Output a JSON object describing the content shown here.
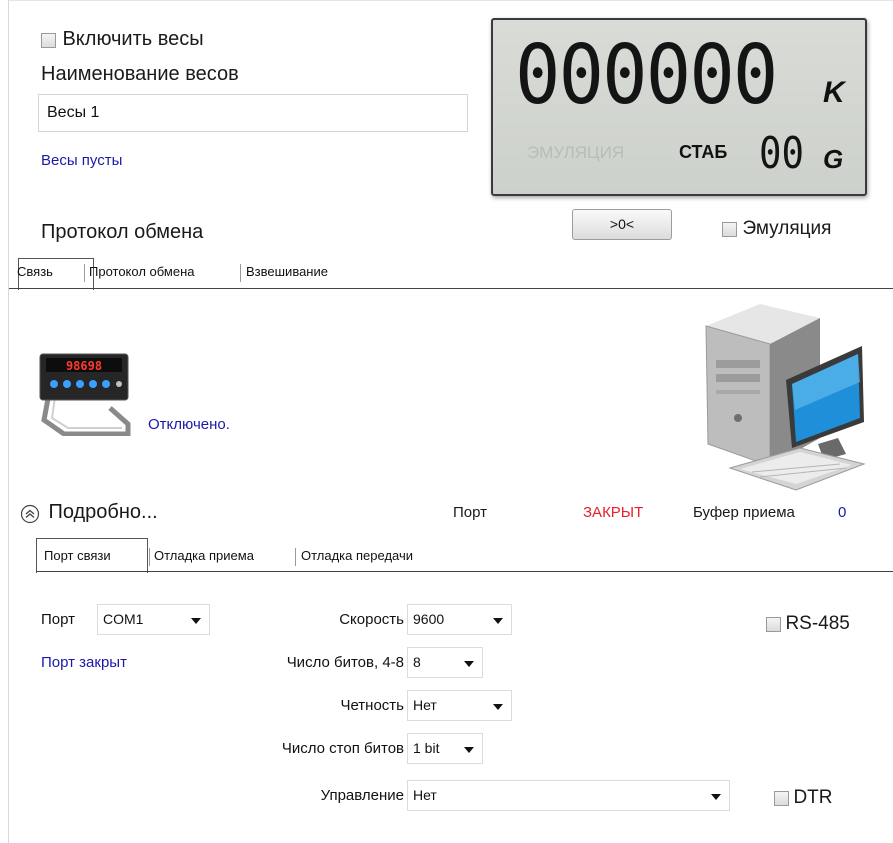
{
  "top": {
    "enable_scales_label": "Включить весы",
    "scales_name_label": "Наименование весов",
    "scales_name_value": "Весы 1",
    "status_text": "Весы пусты",
    "protocol_label": "Протокол обмена"
  },
  "display": {
    "digits": "000000",
    "unit_k": "K",
    "emulation_indicator": "ЭМУЛЯЦИЯ",
    "stab_label": "СТАБ",
    "small_digits": "00",
    "unit_g": "G"
  },
  "controls": {
    "zero_button": ">0<",
    "emulation_label": "Эмуляция"
  },
  "tabs": [
    {
      "label": "Связь"
    },
    {
      "label": "Протокол обмена"
    },
    {
      "label": "Взвешивание"
    }
  ],
  "connection": {
    "state_text": "Отключено.",
    "details_label": "Подробно...",
    "port_label": "Порт",
    "port_state": "ЗАКРЫТ",
    "rx_buffer_label": "Буфер приема",
    "rx_buffer_value": "0"
  },
  "subtabs": [
    {
      "label": "Порт связи"
    },
    {
      "label": "Отладка приема"
    },
    {
      "label": "Отладка передачи"
    }
  ],
  "port_settings": {
    "port_label": "Порт",
    "port_value": "COM1",
    "port_status": "Порт закрыт",
    "speed_label": "Скорость",
    "speed_value": "9600",
    "bits_label": "Число битов, 4-8",
    "bits_value": "8",
    "parity_label": "Четность",
    "parity_value": "Нет",
    "stop_bits_label": "Число стоп битов",
    "stop_bits_value": "1 bit",
    "control_label": "Управление",
    "control_value": "Нет",
    "rs485_label": "RS-485",
    "dtr_label": "DTR"
  },
  "colors": {
    "link": "#1a1aa8",
    "port_closed": "#e8202a",
    "lcd_bg": "#d3d6d0"
  }
}
